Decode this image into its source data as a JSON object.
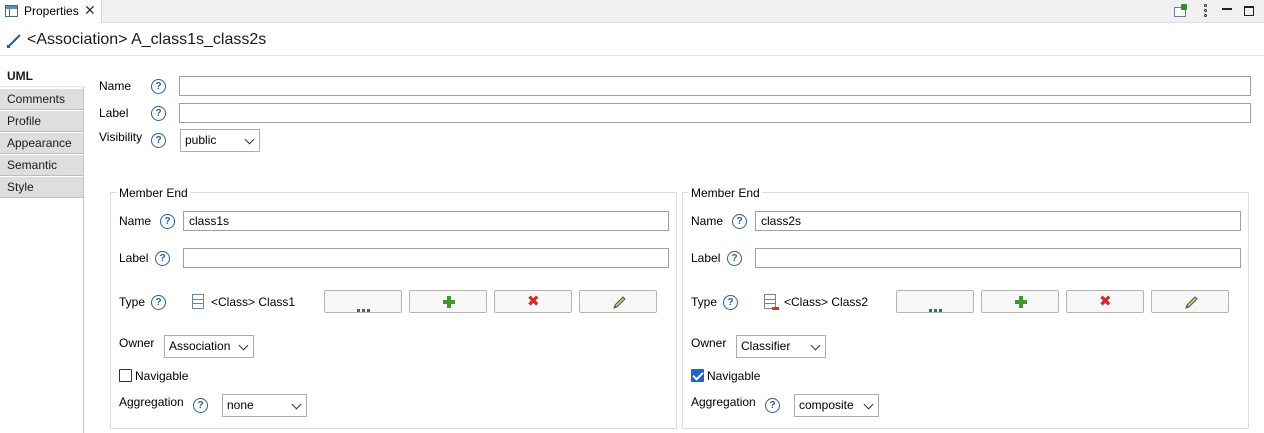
{
  "view": {
    "tab_title": "Properties",
    "close_glyph": "✕"
  },
  "header": {
    "title": "<Association> A_class1s_class2s",
    "icon": "association-icon"
  },
  "side_tabs": [
    "UML",
    "Comments",
    "Profile",
    "Appearance",
    "Semantic",
    "Style"
  ],
  "active_tab": "UML",
  "form": {
    "name_label": "Name",
    "name_value": "",
    "label_label": "Label",
    "label_value": "",
    "visibility_label": "Visibility",
    "visibility_value": "public"
  },
  "help_glyph": "?",
  "member_ends": [
    {
      "group_title": "Member End",
      "name_label": "Name",
      "name_value": "class1s",
      "label_label": "Label",
      "label_value": "",
      "type_label": "Type",
      "type_value": "<Class> Class1",
      "owner_label": "Owner",
      "owner_value": "Association",
      "navigable_label": "Navigable",
      "navigable": false,
      "aggregation_label": "Aggregation",
      "aggregation_value": "none"
    },
    {
      "group_title": "Member End",
      "name_label": "Name",
      "name_value": "class2s",
      "label_label": "Label",
      "label_value": "",
      "type_label": "Type",
      "type_value": "<Class> Class2",
      "owner_label": "Owner",
      "owner_value": "Classifier",
      "navigable_label": "Navigable",
      "navigable": true,
      "aggregation_label": "Aggregation",
      "aggregation_value": "composite"
    }
  ],
  "colors": {
    "help": "#2a5d9a",
    "add": "#3e9a2f",
    "remove": "#d42a22",
    "check": "#1e64c8"
  }
}
